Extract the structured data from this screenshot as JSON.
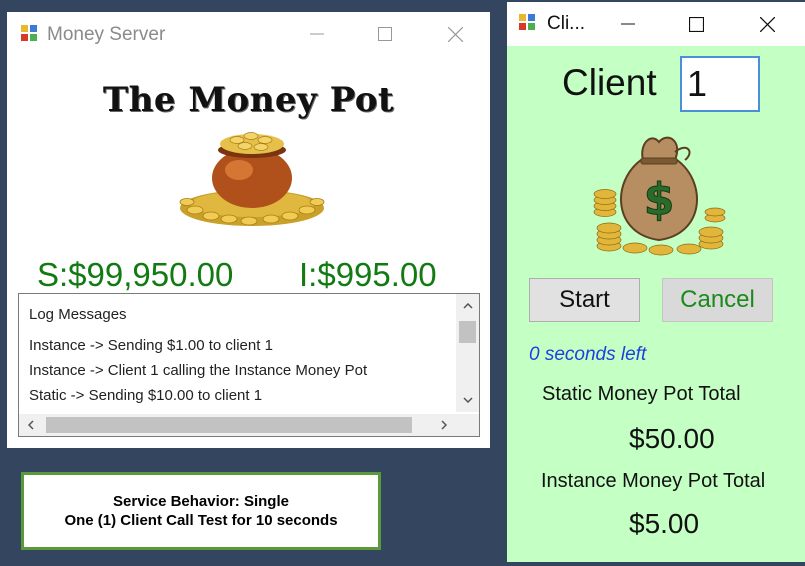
{
  "server": {
    "title": "Money Server",
    "heading": "The Money Pot",
    "static_amount": "S:$99,950.00",
    "instance_amount": "I:$995.00",
    "log": {
      "header": "Log Messages",
      "lines": [
        "Instance -> Sending $1.00 to client 1",
        "Instance -> Client 1 calling the Instance Money Pot",
        "Static -> Sending $10.00 to client 1"
      ]
    }
  },
  "info": {
    "line1": "Service Behavior: Single",
    "line2": "One (1) Client Call Test for 10 seconds"
  },
  "client": {
    "title": "Cli...",
    "label": "Client",
    "input_value": "1",
    "start_label": "Start",
    "cancel_label": "Cancel",
    "seconds_left": "0 seconds left",
    "static_label": "Static Money Pot Total",
    "static_total": "$50.00",
    "instance_label": "Instance Money Pot Total",
    "instance_total": "$5.00"
  },
  "colors": {
    "desktop": "#34465f",
    "client_bg": "#c4ffc4",
    "amount_green": "#127a12",
    "cancel_green": "#1a8a1a",
    "seconds_blue": "#1f3fe0"
  },
  "icons": [
    "app-icon",
    "minimize-icon",
    "maximize-icon",
    "close-icon",
    "money-pot-image",
    "money-bag-image",
    "chevron-up-icon",
    "chevron-down-icon",
    "chevron-left-icon",
    "chevron-right-icon"
  ]
}
